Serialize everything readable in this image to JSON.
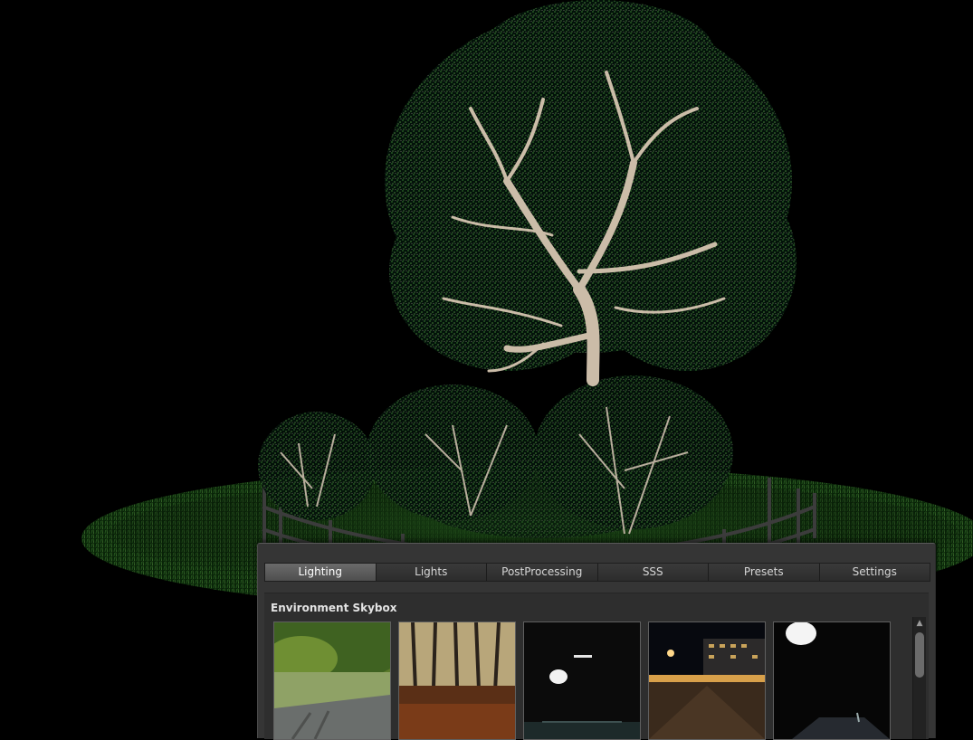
{
  "tabs": [
    "Lighting",
    "Lights",
    "PostProcessing",
    "SSS",
    "Presets",
    "Settings"
  ],
  "active_tab": 0,
  "section_title": "Environment Skybox",
  "skyboxes": [
    {
      "icon": "park-tree-skybox-icon"
    },
    {
      "icon": "autumn-forest-skybox-icon"
    },
    {
      "icon": "dark-studio-skybox-icon"
    },
    {
      "icon": "night-street-skybox-icon"
    },
    {
      "icon": "studio-spotlight-skybox-icon"
    }
  ],
  "colors": {
    "panel_bg": "#353535",
    "tab_active": "#5c5c5c",
    "foliage": "#2f6a2a",
    "bark": "#c8b9a6"
  }
}
